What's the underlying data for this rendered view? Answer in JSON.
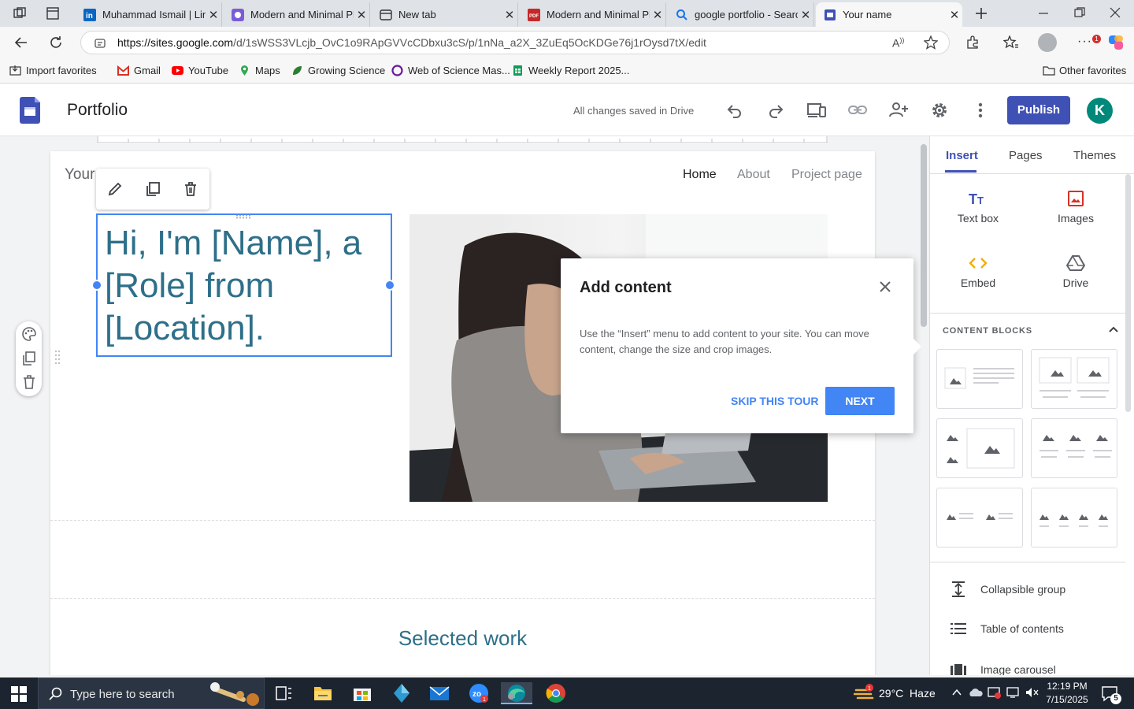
{
  "browser": {
    "tabs": [
      {
        "title": "Muhammad Ismail | Lin",
        "icon": "linkedin-icon"
      },
      {
        "title": "Modern and Minimal Ph",
        "icon": "canva-icon"
      },
      {
        "title": "New tab",
        "icon": "newtab-icon"
      },
      {
        "title": "Modern and Minimal Ph",
        "icon": "pdf-icon"
      },
      {
        "title": "google portfolio - Searc",
        "icon": "search-icon"
      },
      {
        "title": "Your name",
        "icon": "google-sites-icon"
      }
    ],
    "url_domain": "https://sites.google.com",
    "url_path": "/d/1sWSS3VLcjb_OvC1o9RApGVVcCDbxu3cS/p/1nNa_a2X_3ZuEq5OcKDGe76j1rOysd7tX/edit",
    "favorites": [
      {
        "label": "Import favorites",
        "icon": "import-icon"
      },
      {
        "label": "Gmail",
        "icon": "gmail-icon"
      },
      {
        "label": "YouTube",
        "icon": "youtube-icon"
      },
      {
        "label": "Maps",
        "icon": "maps-icon"
      },
      {
        "label": "Growing Science",
        "icon": "growing-science-icon"
      },
      {
        "label": "Web of Science Mas...",
        "icon": "wos-icon"
      },
      {
        "label": "Weekly Report 2025...",
        "icon": "sheets-icon"
      }
    ],
    "other_favorites": "Other favorites"
  },
  "sites": {
    "doc_title": "Portfolio",
    "save_status": "All changes saved in Drive",
    "publish_label": "Publish",
    "avatar_letter": "K",
    "accent": "#3f51b5"
  },
  "page": {
    "site_title": "Your",
    "nav": [
      "Home",
      "About",
      "Project page"
    ],
    "hero_text": "Hi, I'm [Name], a [Role] from [Location].",
    "section_title": "Selected work"
  },
  "tour": {
    "title": "Add content",
    "body": "Use the “Insert” menu to add content to your site. You can move content, change the size and crop images.",
    "skip_label": "SKIP THIS TOUR",
    "next_label": "NEXT"
  },
  "panel": {
    "tabs": [
      "Insert",
      "Pages",
      "Themes"
    ],
    "tools": [
      {
        "label": "Text box",
        "icon": "text-box-icon"
      },
      {
        "label": "Images",
        "icon": "images-icon"
      },
      {
        "label": "Embed",
        "icon": "embed-icon"
      },
      {
        "label": "Drive",
        "icon": "drive-icon"
      }
    ],
    "content_blocks_label": "CONTENT BLOCKS",
    "components": [
      {
        "label": "Collapsible group",
        "icon": "collapsible-icon"
      },
      {
        "label": "Table of contents",
        "icon": "toc-icon"
      },
      {
        "label": "Image carousel",
        "icon": "carousel-icon"
      }
    ]
  },
  "taskbar": {
    "search_placeholder": "Type here to search",
    "weather": "29°C  Haze",
    "time": "12:19 PM",
    "date": "7/15/2025",
    "notification_count": "5"
  }
}
